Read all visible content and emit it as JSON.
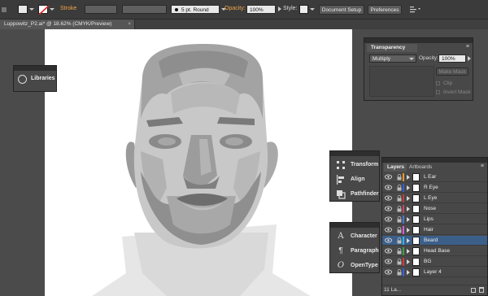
{
  "control_bar": {
    "stroke_label": "Stroke",
    "stroke_profile": "5 pt. Round",
    "opacity_label": "Opacity:",
    "opacity_value": "100%",
    "style_label": "Style:",
    "document_setup": "Document Setup",
    "preferences": "Preferences"
  },
  "document_tab": {
    "title": "Luppowitz_P2.ai* @ 18.62% (CMYK/Preview)"
  },
  "libraries_panel": {
    "label": "Libraries"
  },
  "transparency_panel": {
    "title": "Transparency",
    "blend_mode": "Multiply",
    "opacity_label": "Opacity:",
    "opacity_value": "100%",
    "make_mask": "Make Mask",
    "clip": "Clip",
    "invert_mask": "Invert Mask"
  },
  "properties_panel": {
    "items": [
      {
        "label": "Transform",
        "icon": "transform-icon"
      },
      {
        "label": "Align",
        "icon": "align-icon"
      },
      {
        "label": "Pathfinder",
        "icon": "pathfinder-icon"
      }
    ]
  },
  "type_panel": {
    "items": [
      {
        "label": "Character",
        "icon": "character-icon"
      },
      {
        "label": "Paragraph",
        "icon": "paragraph-icon"
      },
      {
        "label": "OpenType",
        "icon": "opentype-icon"
      }
    ]
  },
  "layers_panel": {
    "tabs": [
      "Layers",
      "Artboards"
    ],
    "layers": [
      {
        "name": "L Ear",
        "color": "#e59a2c",
        "selected": false
      },
      {
        "name": "R Eye",
        "color": "#2f5fd8",
        "selected": false
      },
      {
        "name": "L Eye",
        "color": "#c53a3a",
        "selected": false
      },
      {
        "name": "Nose",
        "color": "#c6485e",
        "selected": false
      },
      {
        "name": "Lips",
        "color": "#4a7ad8",
        "selected": false
      },
      {
        "name": "Hair",
        "color": "#e059d9",
        "selected": false
      },
      {
        "name": "Beard",
        "color": "#2fb7e0",
        "selected": true
      },
      {
        "name": "Head Base",
        "color": "#3aa24a",
        "selected": false
      },
      {
        "name": "BG",
        "color": "#d63a3a",
        "selected": false
      },
      {
        "name": "Layer 4",
        "color": "#3a5fe0",
        "selected": false
      }
    ],
    "footer_count": "11 La..."
  },
  "colors": {
    "accent_orange": "#f0a447",
    "selection": "#3c5f8a"
  }
}
